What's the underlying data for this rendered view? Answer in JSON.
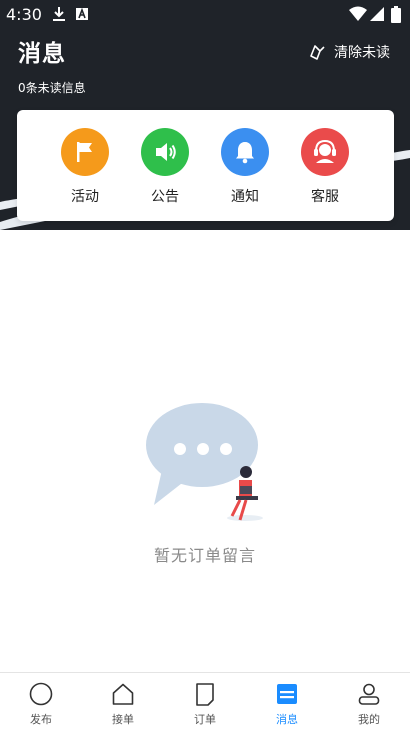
{
  "status_bar": {
    "time": "4:30"
  },
  "header": {
    "title": "消息",
    "clear_unread_label": "清除未读",
    "unread_count_text": "0条未读信息"
  },
  "categories": [
    {
      "label": "活动",
      "icon": "flag-icon",
      "color": "#f59a1b"
    },
    {
      "label": "公告",
      "icon": "speaker-icon",
      "color": "#2fbf4b"
    },
    {
      "label": "通知",
      "icon": "bell-icon",
      "color": "#3b8ff0"
    },
    {
      "label": "客服",
      "icon": "headset-icon",
      "color": "#ea4b4b"
    }
  ],
  "empty_state": {
    "text": "暂无订单留言"
  },
  "bottom_nav": {
    "active_color": "#1a8cff",
    "items": [
      {
        "label": "发布",
        "icon": "circle-icon"
      },
      {
        "label": "接单",
        "icon": "home-icon"
      },
      {
        "label": "订单",
        "icon": "document-icon"
      },
      {
        "label": "消息",
        "icon": "message-icon",
        "active": true
      },
      {
        "label": "我的",
        "icon": "user-icon"
      }
    ]
  }
}
